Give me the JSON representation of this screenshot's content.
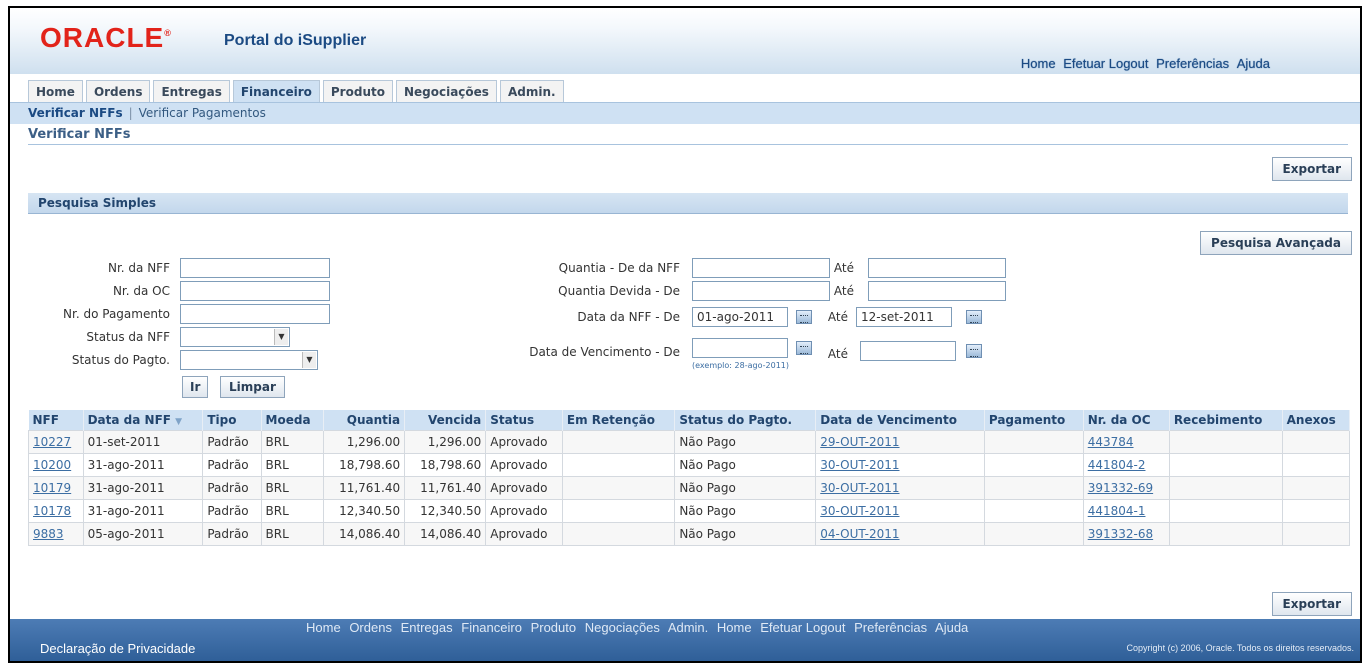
{
  "header": {
    "logo": "ORACLE",
    "logo_mark": "®",
    "title": "Portal do iSupplier",
    "global_links": [
      "Home",
      "Efetuar Logout",
      "Preferências",
      "Ajuda"
    ]
  },
  "tabs": [
    "Home",
    "Ordens",
    "Entregas",
    "Financeiro",
    "Produto",
    "Negociações",
    "Admin."
  ],
  "active_tab": "Financeiro",
  "subnav": {
    "active": "Verificar NFFs",
    "link": "Verificar Pagamentos"
  },
  "page_title": "Verificar NFFs",
  "buttons": {
    "export": "Exportar",
    "advanced_search": "Pesquisa Avançada",
    "go": "Ir",
    "clear": "Limpar"
  },
  "search": {
    "section_title": "Pesquisa Simples",
    "labels": {
      "nff_number": "Nr. da NFF",
      "po_number": "Nr. da OC",
      "payment_number": "Nr. do Pagamento",
      "nff_status": "Status da NFF",
      "payment_status": "Status do Pagto.",
      "nff_amount_from": "Quantia - De da NFF",
      "amount_due_from": "Quantia Devida - De",
      "nff_date_from": "Data da NFF - De",
      "due_date_from": "Data de Vencimento - De",
      "to": "Até"
    },
    "values": {
      "nff_date_from": "01-ago-2011",
      "nff_date_to": "12-set-2011"
    },
    "date_hint": "(exemplo: 28-ago-2011)"
  },
  "table": {
    "columns": [
      "NFF",
      "Data da NFF",
      "Tipo",
      "Moeda",
      "Quantia",
      "Vencida",
      "Status",
      "Em Retenção",
      "Status do Pagto.",
      "Data de Vencimento",
      "Pagamento",
      "Nr. da OC",
      "Recebimento",
      "Anexos"
    ],
    "sort_indicator": "▼",
    "rows": [
      {
        "nff": "10227",
        "date": "01-set-2011",
        "type": "Padrão",
        "currency": "BRL",
        "amount": "1,296.00",
        "due": "1,296.00",
        "status": "Aprovado",
        "hold": "",
        "pay_status": "Não Pago",
        "due_date": "29-OUT-2011",
        "payment": "",
        "po": "443784",
        "receipt": "",
        "attach": ""
      },
      {
        "nff": "10200",
        "date": "31-ago-2011",
        "type": "Padrão",
        "currency": "BRL",
        "amount": "18,798.60",
        "due": "18,798.60",
        "status": "Aprovado",
        "hold": "",
        "pay_status": "Não Pago",
        "due_date": "30-OUT-2011",
        "payment": "",
        "po": "441804-2",
        "receipt": "",
        "attach": ""
      },
      {
        "nff": "10179",
        "date": "31-ago-2011",
        "type": "Padrão",
        "currency": "BRL",
        "amount": "11,761.40",
        "due": "11,761.40",
        "status": "Aprovado",
        "hold": "",
        "pay_status": "Não Pago",
        "due_date": "30-OUT-2011",
        "payment": "",
        "po": "391332-69",
        "receipt": "",
        "attach": ""
      },
      {
        "nff": "10178",
        "date": "31-ago-2011",
        "type": "Padrão",
        "currency": "BRL",
        "amount": "12,340.50",
        "due": "12,340.50",
        "status": "Aprovado",
        "hold": "",
        "pay_status": "Não Pago",
        "due_date": "30-OUT-2011",
        "payment": "",
        "po": "441804-1",
        "receipt": "",
        "attach": ""
      },
      {
        "nff": "9883",
        "date": "05-ago-2011",
        "type": "Padrão",
        "currency": "BRL",
        "amount": "14,086.40",
        "due": "14,086.40",
        "status": "Aprovado",
        "hold": "",
        "pay_status": "Não Pago",
        "due_date": "04-OUT-2011",
        "payment": "",
        "po": "391332-68",
        "receipt": "",
        "attach": ""
      }
    ]
  },
  "footer": {
    "links": [
      "Home",
      "Ordens",
      "Entregas",
      "Financeiro",
      "Produto",
      "Negociações",
      "Admin.",
      "Home",
      "Efetuar Logout",
      "Preferências",
      "Ajuda"
    ],
    "privacy": "Declaração de Privacidade",
    "copyright": "Copyright (c) 2006, Oracle. Todos os direitos reservados."
  },
  "colors": {
    "brand_red": "#e2231a",
    "header_blue": "#1b4a83",
    "tab_active": "#cfe1f3",
    "link": "#3c6ea3",
    "footer": "#2f5f98"
  }
}
